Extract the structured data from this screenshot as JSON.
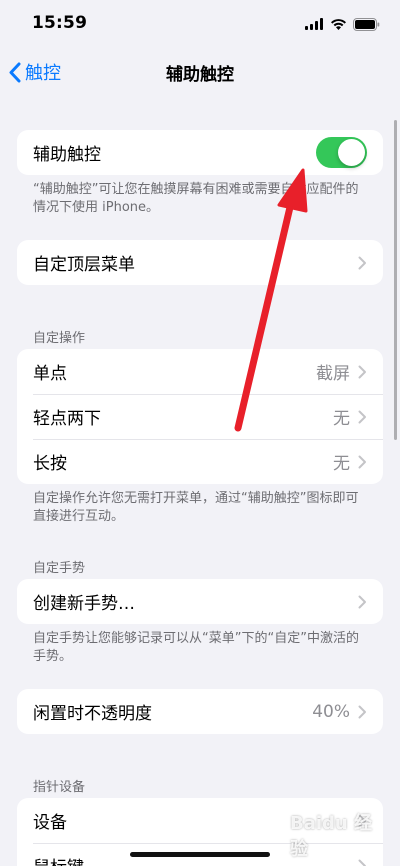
{
  "status_bar": {
    "time": "15:59"
  },
  "nav": {
    "back_label": "触控",
    "title": "辅助触控"
  },
  "assistive_touch": {
    "label": "辅助触控",
    "enabled": true,
    "footnote": "“辅助触控”可让您在触摸屏幕有困难或需要自适应配件的情况下使用 iPhone。"
  },
  "top_menu": {
    "label": "自定顶层菜单"
  },
  "custom_actions": {
    "header": "自定操作",
    "rows": [
      {
        "label": "单点",
        "value": "截屏"
      },
      {
        "label": "轻点两下",
        "value": "无"
      },
      {
        "label": "长按",
        "value": "无"
      }
    ],
    "footnote": "自定操作允许您无需打开菜单，通过“辅助触控”图标即可直接进行互动。"
  },
  "custom_gestures": {
    "header": "自定手势",
    "create_label": "创建新手势…",
    "footnote": "自定手势让您能够记录可以从“菜单”下的“自定”中激活的手势。"
  },
  "idle_opacity": {
    "label": "闲置时不透明度",
    "value": "40%"
  },
  "pointer_devices": {
    "header": "指针设备",
    "rows": [
      {
        "label": "设备"
      },
      {
        "label": "鼠标键"
      }
    ]
  },
  "watermark": {
    "text": "Baidu 经验"
  },
  "colors": {
    "accent": "#0a7aff",
    "toggle_on": "#34c759",
    "arrow": "#e8202a"
  }
}
